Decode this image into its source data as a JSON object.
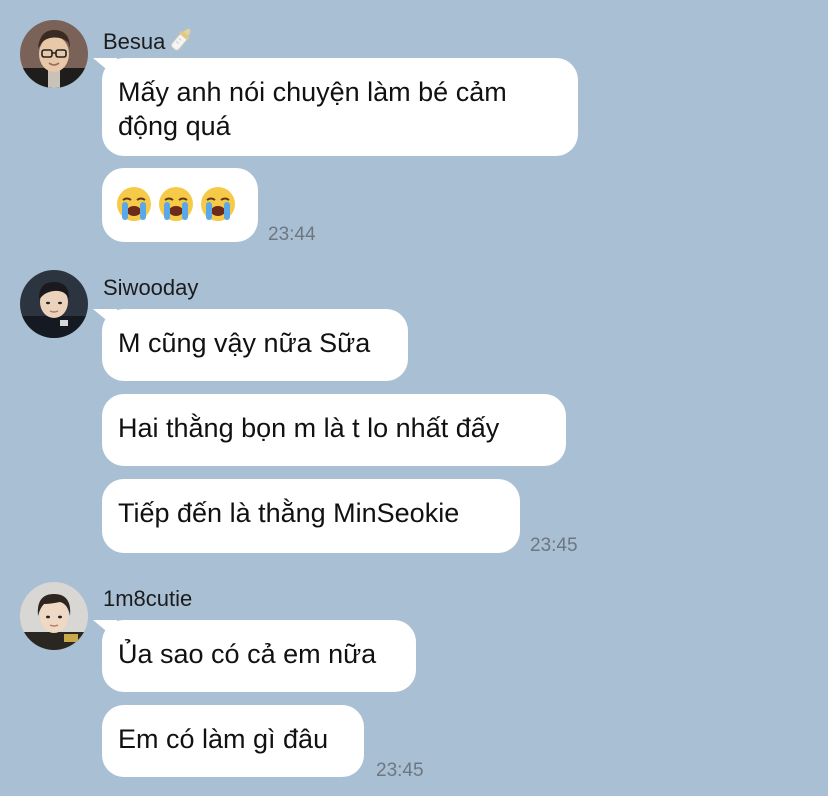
{
  "groups": [
    {
      "sender": "Besua",
      "sender_badge": "baby-bottle-icon",
      "messages": [
        {
          "text": "Mấy anh nói chuyện làm bé cảm động quá"
        },
        {
          "emojis": [
            "loudly-crying-face-icon",
            "loudly-crying-face-icon",
            "loudly-crying-face-icon"
          ]
        }
      ],
      "time": "23:44"
    },
    {
      "sender": "Siwooday",
      "messages": [
        {
          "text": "M cũng vậy nữa Sữa"
        },
        {
          "text": "Hai thằng bọn m là t lo nhất đấy"
        },
        {
          "text": "Tiếp đến là thằng MinSeokie"
        }
      ],
      "time": "23:45"
    },
    {
      "sender": "1m8cutie",
      "messages": [
        {
          "text": "Ủa sao có cả em nữa"
        },
        {
          "text": "Em có làm gì đâu"
        }
      ],
      "time": "23:45"
    }
  ],
  "colors": {
    "background": "#a9bfd3",
    "bubble": "#ffffff",
    "timestamp": "#6d7781"
  }
}
